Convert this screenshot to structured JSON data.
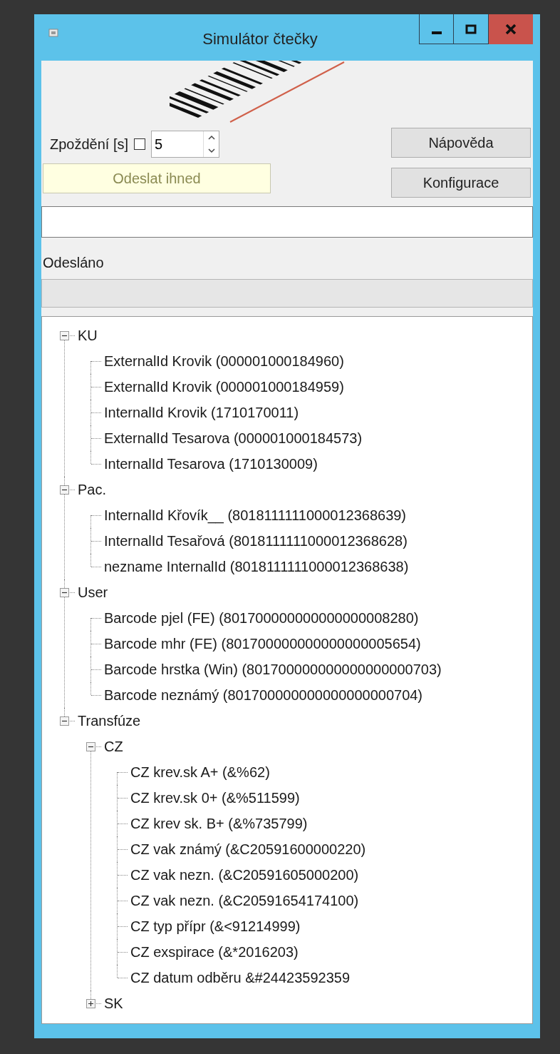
{
  "window": {
    "title": "Simulátor čtečky"
  },
  "delay": {
    "label": "Zpoždění [s]",
    "checked": false,
    "value": "5"
  },
  "buttons": [
    "Nápověda",
    "Konfigurace"
  ],
  "send_now": {
    "label": "Odeslat ihned"
  },
  "sent": {
    "label": "Odesláno"
  },
  "tree": [
    {
      "label": "KU",
      "expanded": true,
      "children": [
        {
          "label": "ExternalId Krovik (000001000184960)"
        },
        {
          "label": "ExternalId Krovik (000001000184959)"
        },
        {
          "label": "InternalId Krovik (1710170011)"
        },
        {
          "label": "ExternalId Tesarova (000001000184573)"
        },
        {
          "label": "InternalId Tesarova (1710130009)"
        }
      ]
    },
    {
      "label": "Pac.",
      "expanded": true,
      "children": [
        {
          "label": "InternalId Křovík__ (8018111111000012368639)"
        },
        {
          "label": "InternalId Tesařová (8018111111000012368628)"
        },
        {
          "label": "nezname InternalId (8018111111000012368638)"
        }
      ]
    },
    {
      "label": "User",
      "expanded": true,
      "children": [
        {
          "label": "Barcode pjel (FE) (801700000000000000008280)"
        },
        {
          "label": "Barcode mhr (FE) (801700000000000000005654)"
        },
        {
          "label": "Barcode hrstka (Win) (801700000000000000000703)"
        },
        {
          "label": "Barcode neznámý (801700000000000000000704)"
        }
      ]
    },
    {
      "label": "Transfúze",
      "expanded": true,
      "children": [
        {
          "label": "CZ",
          "expanded": true,
          "children": [
            {
              "label": "CZ krev.sk A+ (&%62)"
            },
            {
              "label": "CZ krev.sk 0+ (&%511599)"
            },
            {
              "label": "CZ krev sk. B+ (&%735799)"
            },
            {
              "label": "CZ vak známý (&C20591600000220)"
            },
            {
              "label": "CZ vak nezn. (&C20591605000200)"
            },
            {
              "label": "CZ vak nezn. (&C20591654174100)"
            },
            {
              "label": "CZ typ přípr (&<91214999)"
            },
            {
              "label": "CZ exspirace (&*2016203)"
            },
            {
              "label": "CZ datum odběru &#24423592359"
            }
          ]
        },
        {
          "label": "SK",
          "expanded": false
        }
      ]
    }
  ]
}
